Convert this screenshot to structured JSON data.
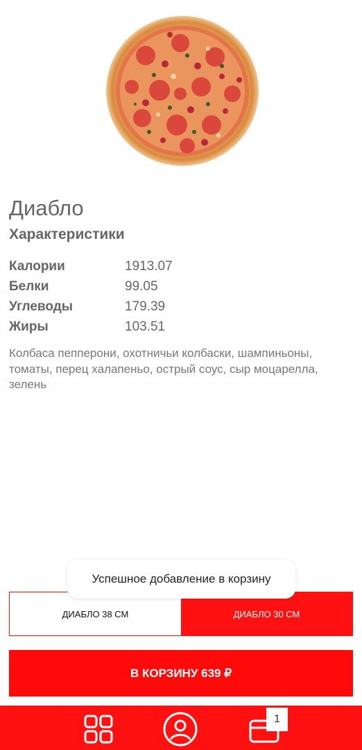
{
  "product": {
    "name": "Диабло",
    "image_icon": "pizza-photo"
  },
  "characteristics": {
    "title": "Характеристики",
    "items": [
      {
        "label": "Калории",
        "value": "1913.07"
      },
      {
        "label": "Белки",
        "value": "99.05"
      },
      {
        "label": "Углеводы",
        "value": "179.39"
      },
      {
        "label": "Жиры",
        "value": "103.51"
      }
    ]
  },
  "description": "Колбаса пепперони, охотничьи колбаски, шампиньоны, томаты, перец халапеньо, острый соус, сыр моцарелла, зелень",
  "toast": {
    "message": "Успешное добавление в корзину"
  },
  "sizes": [
    {
      "label": "ДИАБЛО  38 СМ",
      "selected": false
    },
    {
      "label": "ДИАБЛО  30 СМ",
      "selected": true
    }
  ],
  "cart_button": {
    "label": "В КОРЗИНУ 639 ₽"
  },
  "bottom_nav": {
    "items": [
      {
        "icon": "grid-menu-icon"
      },
      {
        "icon": "user-profile-icon"
      },
      {
        "icon": "wallet-cart-icon"
      }
    ],
    "cart_badge": "1"
  },
  "colors": {
    "accent": "#ff1111",
    "text": "#666666",
    "background": "#ffffff"
  }
}
